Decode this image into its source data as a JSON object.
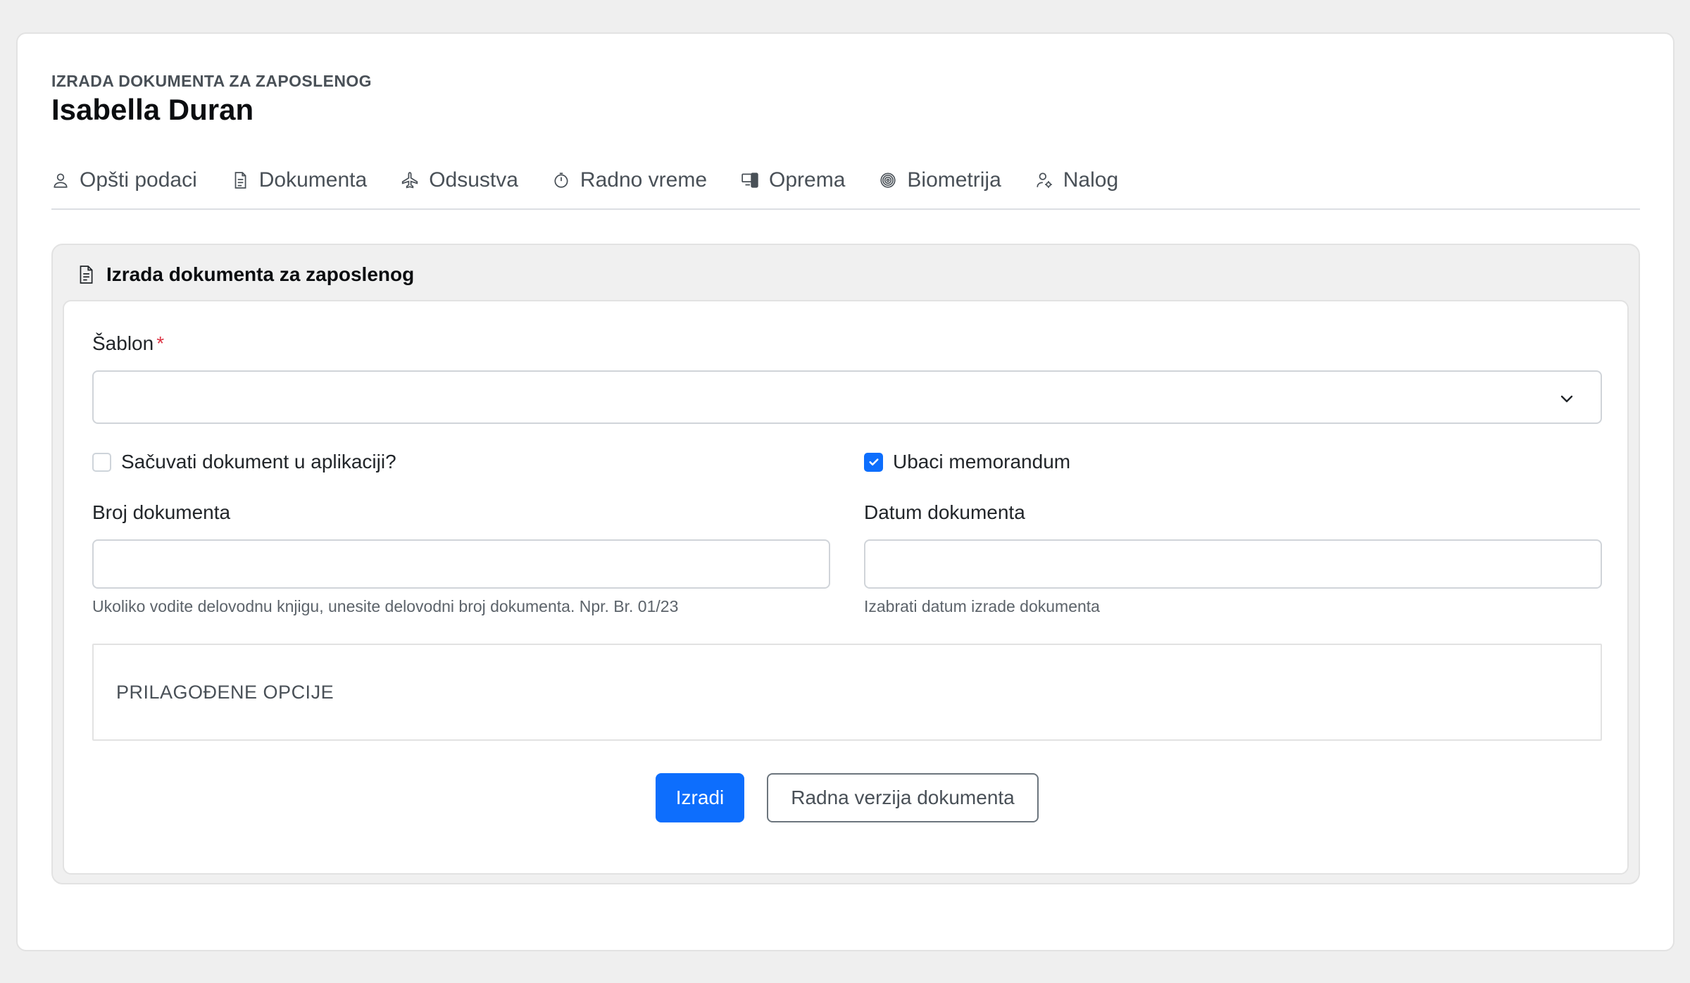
{
  "header": {
    "eyebrow": "IZRADA DOKUMENTA ZA ZAPOSLENOG",
    "employee_name": "Isabella Duran"
  },
  "tabs": [
    {
      "label": "Opšti podaci",
      "icon": "user-icon"
    },
    {
      "label": "Dokumenta",
      "icon": "document-icon"
    },
    {
      "label": "Odsustva",
      "icon": "airplane-icon"
    },
    {
      "label": "Radno vreme",
      "icon": "stopwatch-icon"
    },
    {
      "label": "Oprema",
      "icon": "devices-icon"
    },
    {
      "label": "Biometrija",
      "icon": "fingerprint-icon"
    },
    {
      "label": "Nalog",
      "icon": "user-gear-icon"
    }
  ],
  "panel": {
    "title": "Izrada dokumenta za zaposlenog",
    "template_label": "Šablon",
    "template_required_mark": "*",
    "template_value": "",
    "save_in_app_label": "Sačuvati dokument u aplikaciji?",
    "save_in_app_checked": false,
    "letterhead_label": "Ubaci memorandum",
    "letterhead_checked": true,
    "doc_number_label": "Broj dokumenta",
    "doc_number_value": "",
    "doc_number_hint": "Ukoliko vodite delovodnu knjigu, unesite delovodni broj dokumenta. Npr. Br. 01/23",
    "doc_date_label": "Datum dokumenta",
    "doc_date_value": "",
    "doc_date_hint": "Izabrati datum izrade dokumenta",
    "custom_options_label": "PRILAGOĐENE OPCIJE",
    "create_button": "Izradi",
    "draft_button": "Radna verzija dokumenta"
  },
  "colors": {
    "accent": "#0d6efd",
    "required": "#dc3545",
    "background": "#efefef"
  }
}
